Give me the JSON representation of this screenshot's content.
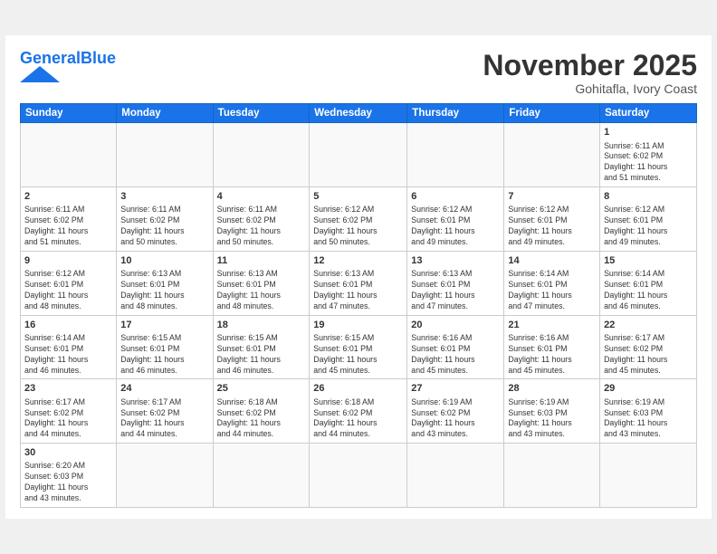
{
  "header": {
    "logo_general": "General",
    "logo_blue": "Blue",
    "month_title": "November 2025",
    "location": "Gohitafla, Ivory Coast"
  },
  "weekdays": [
    "Sunday",
    "Monday",
    "Tuesday",
    "Wednesday",
    "Thursday",
    "Friday",
    "Saturday"
  ],
  "weeks": [
    [
      {
        "day": "",
        "info": ""
      },
      {
        "day": "",
        "info": ""
      },
      {
        "day": "",
        "info": ""
      },
      {
        "day": "",
        "info": ""
      },
      {
        "day": "",
        "info": ""
      },
      {
        "day": "",
        "info": ""
      },
      {
        "day": "1",
        "info": "Sunrise: 6:11 AM\nSunset: 6:02 PM\nDaylight: 11 hours\nand 51 minutes."
      }
    ],
    [
      {
        "day": "2",
        "info": "Sunrise: 6:11 AM\nSunset: 6:02 PM\nDaylight: 11 hours\nand 51 minutes."
      },
      {
        "day": "3",
        "info": "Sunrise: 6:11 AM\nSunset: 6:02 PM\nDaylight: 11 hours\nand 50 minutes."
      },
      {
        "day": "4",
        "info": "Sunrise: 6:11 AM\nSunset: 6:02 PM\nDaylight: 11 hours\nand 50 minutes."
      },
      {
        "day": "5",
        "info": "Sunrise: 6:12 AM\nSunset: 6:02 PM\nDaylight: 11 hours\nand 50 minutes."
      },
      {
        "day": "6",
        "info": "Sunrise: 6:12 AM\nSunset: 6:01 PM\nDaylight: 11 hours\nand 49 minutes."
      },
      {
        "day": "7",
        "info": "Sunrise: 6:12 AM\nSunset: 6:01 PM\nDaylight: 11 hours\nand 49 minutes."
      },
      {
        "day": "8",
        "info": "Sunrise: 6:12 AM\nSunset: 6:01 PM\nDaylight: 11 hours\nand 49 minutes."
      }
    ],
    [
      {
        "day": "9",
        "info": "Sunrise: 6:12 AM\nSunset: 6:01 PM\nDaylight: 11 hours\nand 48 minutes."
      },
      {
        "day": "10",
        "info": "Sunrise: 6:13 AM\nSunset: 6:01 PM\nDaylight: 11 hours\nand 48 minutes."
      },
      {
        "day": "11",
        "info": "Sunrise: 6:13 AM\nSunset: 6:01 PM\nDaylight: 11 hours\nand 48 minutes."
      },
      {
        "day": "12",
        "info": "Sunrise: 6:13 AM\nSunset: 6:01 PM\nDaylight: 11 hours\nand 47 minutes."
      },
      {
        "day": "13",
        "info": "Sunrise: 6:13 AM\nSunset: 6:01 PM\nDaylight: 11 hours\nand 47 minutes."
      },
      {
        "day": "14",
        "info": "Sunrise: 6:14 AM\nSunset: 6:01 PM\nDaylight: 11 hours\nand 47 minutes."
      },
      {
        "day": "15",
        "info": "Sunrise: 6:14 AM\nSunset: 6:01 PM\nDaylight: 11 hours\nand 46 minutes."
      }
    ],
    [
      {
        "day": "16",
        "info": "Sunrise: 6:14 AM\nSunset: 6:01 PM\nDaylight: 11 hours\nand 46 minutes."
      },
      {
        "day": "17",
        "info": "Sunrise: 6:15 AM\nSunset: 6:01 PM\nDaylight: 11 hours\nand 46 minutes."
      },
      {
        "day": "18",
        "info": "Sunrise: 6:15 AM\nSunset: 6:01 PM\nDaylight: 11 hours\nand 46 minutes."
      },
      {
        "day": "19",
        "info": "Sunrise: 6:15 AM\nSunset: 6:01 PM\nDaylight: 11 hours\nand 45 minutes."
      },
      {
        "day": "20",
        "info": "Sunrise: 6:16 AM\nSunset: 6:01 PM\nDaylight: 11 hours\nand 45 minutes."
      },
      {
        "day": "21",
        "info": "Sunrise: 6:16 AM\nSunset: 6:01 PM\nDaylight: 11 hours\nand 45 minutes."
      },
      {
        "day": "22",
        "info": "Sunrise: 6:17 AM\nSunset: 6:02 PM\nDaylight: 11 hours\nand 45 minutes."
      }
    ],
    [
      {
        "day": "23",
        "info": "Sunrise: 6:17 AM\nSunset: 6:02 PM\nDaylight: 11 hours\nand 44 minutes."
      },
      {
        "day": "24",
        "info": "Sunrise: 6:17 AM\nSunset: 6:02 PM\nDaylight: 11 hours\nand 44 minutes."
      },
      {
        "day": "25",
        "info": "Sunrise: 6:18 AM\nSunset: 6:02 PM\nDaylight: 11 hours\nand 44 minutes."
      },
      {
        "day": "26",
        "info": "Sunrise: 6:18 AM\nSunset: 6:02 PM\nDaylight: 11 hours\nand 44 minutes."
      },
      {
        "day": "27",
        "info": "Sunrise: 6:19 AM\nSunset: 6:02 PM\nDaylight: 11 hours\nand 43 minutes."
      },
      {
        "day": "28",
        "info": "Sunrise: 6:19 AM\nSunset: 6:03 PM\nDaylight: 11 hours\nand 43 minutes."
      },
      {
        "day": "29",
        "info": "Sunrise: 6:19 AM\nSunset: 6:03 PM\nDaylight: 11 hours\nand 43 minutes."
      }
    ],
    [
      {
        "day": "30",
        "info": "Sunrise: 6:20 AM\nSunset: 6:03 PM\nDaylight: 11 hours\nand 43 minutes."
      },
      {
        "day": "",
        "info": ""
      },
      {
        "day": "",
        "info": ""
      },
      {
        "day": "",
        "info": ""
      },
      {
        "day": "",
        "info": ""
      },
      {
        "day": "",
        "info": ""
      },
      {
        "day": "",
        "info": ""
      }
    ]
  ]
}
